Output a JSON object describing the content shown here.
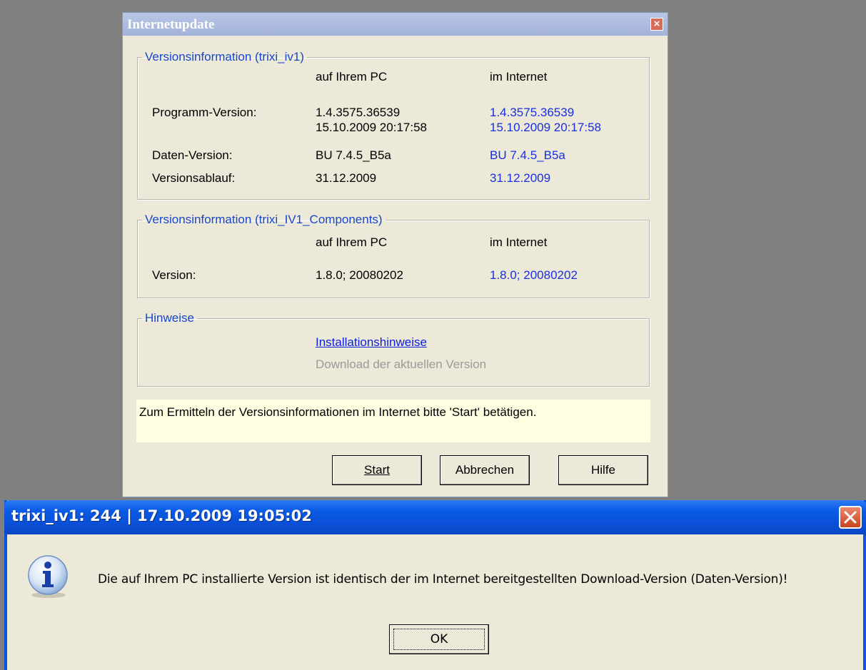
{
  "update_dialog": {
    "title": "Internetupdate",
    "group1": {
      "legend": "Versionsinformation  (trixi_iv1)",
      "col_pc": "auf Ihrem PC",
      "col_internet": "im Internet",
      "rows": [
        {
          "label": "Programm-Version:",
          "pc": "1.4.3575.36539",
          "pc2": "15.10.2009 20:17:58",
          "net": "1.4.3575.36539",
          "net2": "15.10.2009 20:17:58"
        },
        {
          "label": "Daten-Version:",
          "pc": "BU 7.4.5_B5a",
          "net": "BU 7.4.5_B5a"
        },
        {
          "label": "Versionsablauf:",
          "pc": "31.12.2009",
          "net": "31.12.2009"
        }
      ]
    },
    "group2": {
      "legend": "Versionsinformation  (trixi_IV1_Components)",
      "col_pc": "auf Ihrem PC",
      "col_internet": "im Internet",
      "label": "Version:",
      "pc": "1.8.0; 20080202",
      "net": "1.8.0; 20080202"
    },
    "group3": {
      "legend": "Hinweise",
      "link_install": "Installationshinweise",
      "download": "Download der aktuellen Version"
    },
    "info_text": "Zum Ermitteln  der Versionsinformationen  im  Internet  bitte  'Start'  betätigen.",
    "buttons": {
      "start": "Start",
      "cancel": "Abbrechen",
      "help": "Hilfe"
    }
  },
  "message_box": {
    "title": "trixi_iv1: 244 | 17.10.2009 19:05:02",
    "icon": "info-icon",
    "text": "Die auf Ihrem PC installierte Version ist identisch der im Internet bereitgestellten Download-Version (Daten-Version)!",
    "ok": "OK"
  }
}
